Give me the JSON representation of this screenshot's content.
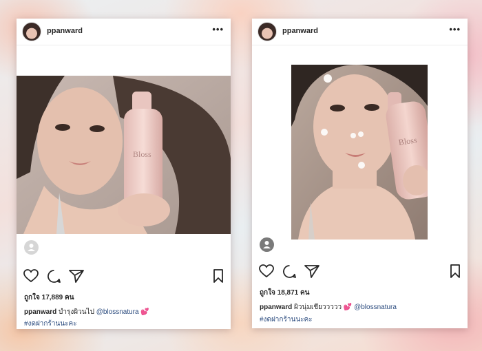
{
  "posts": [
    {
      "username": "ppanward",
      "more_icon": "more-icon",
      "photo_bottle_text": "Bloss",
      "likes": "ถูกใจ 17,889 คน",
      "caption_user": "ppanward",
      "caption_text": " บำรุงผิวนไป ",
      "mention": "@blossnatura",
      "emoji": "💕",
      "hashtag": "#งดฝากร้านนะคะ"
    },
    {
      "username": "ppanward",
      "more_icon": "more-icon",
      "photo_bottle_text": "Bloss",
      "likes": "ถูกใจ 18,871 คน",
      "caption_user": "ppanward",
      "caption_text": " ผิวนุ่มเชียววววว ",
      "mention": "@blossnatura",
      "emoji": "💕",
      "hashtag": "#งดฝากร้านนะคะ"
    }
  ],
  "icons": [
    "heart-icon",
    "comment-icon",
    "send-icon",
    "bookmark-icon",
    "tag-people-icon"
  ],
  "colors": {
    "mention": "#2b4b7e",
    "text": "#262626",
    "card": "#ffffff"
  }
}
